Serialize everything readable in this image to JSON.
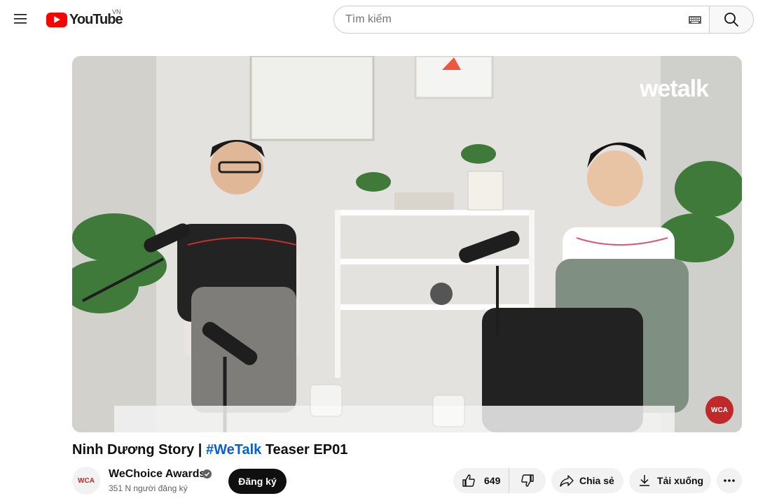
{
  "header": {
    "logo_text": "YouTube",
    "country_code": "VN",
    "search_placeholder": "Tìm kiếm"
  },
  "video": {
    "watermark": "wetalk",
    "corner_badge": "WCA",
    "title_prefix": "Ninh Dương Story | ",
    "title_hashtag": "#WeTalk",
    "title_suffix": " Teaser EP01"
  },
  "channel": {
    "avatar_text": "WCA",
    "name": "WeChoice Awards",
    "subscribers": "351 N người đăng ký",
    "subscribe_label": "Đăng ký"
  },
  "actions": {
    "like_count": "649",
    "share_label": "Chia sẻ",
    "download_label": "Tải xuống"
  },
  "colors": {
    "brand_red": "#ff0000",
    "link_blue": "#065fd4",
    "subscribe_bg": "#0f0f0f"
  }
}
